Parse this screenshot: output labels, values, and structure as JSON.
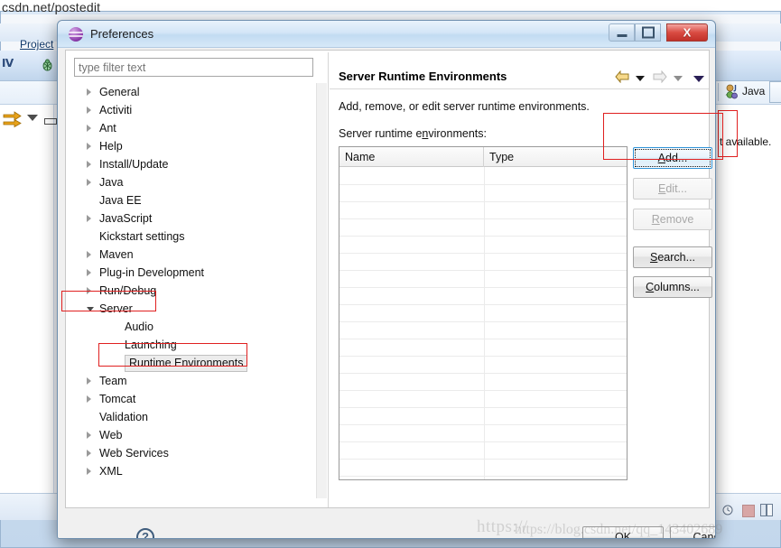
{
  "background": {
    "url_text": "csdn.net/postedit",
    "menu_project": "Project",
    "perspective_label": "Java",
    "editor_text": "t available.",
    "icons": {
      "debug": "bug-icon",
      "run": "run-icon",
      "arrows": "link-arrows-icon",
      "clock": "clock-icon",
      "stop": "stop-icon",
      "panes": "panes-icon"
    }
  },
  "dialog": {
    "title": "Preferences",
    "window_controls": {
      "minimize": "minimize-icon",
      "maximize": "maximize-icon",
      "close": "X"
    },
    "filter": {
      "value": "",
      "placeholder": "type filter text"
    },
    "tree": [
      {
        "label": "General",
        "indent": 0,
        "twisty": "collapsed",
        "selected": false
      },
      {
        "label": "Activiti",
        "indent": 0,
        "twisty": "collapsed",
        "selected": false
      },
      {
        "label": "Ant",
        "indent": 0,
        "twisty": "collapsed",
        "selected": false
      },
      {
        "label": "Help",
        "indent": 0,
        "twisty": "collapsed",
        "selected": false
      },
      {
        "label": "Install/Update",
        "indent": 0,
        "twisty": "collapsed",
        "selected": false
      },
      {
        "label": "Java",
        "indent": 0,
        "twisty": "collapsed",
        "selected": false
      },
      {
        "label": "Java EE",
        "indent": 0,
        "twisty": "none",
        "selected": false
      },
      {
        "label": "JavaScript",
        "indent": 0,
        "twisty": "collapsed",
        "selected": false
      },
      {
        "label": "Kickstart settings",
        "indent": 0,
        "twisty": "none",
        "selected": false
      },
      {
        "label": "Maven",
        "indent": 0,
        "twisty": "collapsed",
        "selected": false
      },
      {
        "label": "Plug-in Development",
        "indent": 0,
        "twisty": "collapsed",
        "selected": false
      },
      {
        "label": "Run/Debug",
        "indent": 0,
        "twisty": "collapsed",
        "selected": false
      },
      {
        "label": "Server",
        "indent": 0,
        "twisty": "expanded",
        "selected": false
      },
      {
        "label": "Audio",
        "indent": 1,
        "twisty": "none",
        "selected": false
      },
      {
        "label": "Launching",
        "indent": 1,
        "twisty": "none",
        "selected": false
      },
      {
        "label": "Runtime Environments",
        "indent": 1,
        "twisty": "none",
        "selected": true
      },
      {
        "label": "Team",
        "indent": 0,
        "twisty": "collapsed",
        "selected": false
      },
      {
        "label": "Tomcat",
        "indent": 0,
        "twisty": "collapsed",
        "selected": false
      },
      {
        "label": "Validation",
        "indent": 0,
        "twisty": "none",
        "selected": false
      },
      {
        "label": "Web",
        "indent": 0,
        "twisty": "collapsed",
        "selected": false
      },
      {
        "label": "Web Services",
        "indent": 0,
        "twisty": "collapsed",
        "selected": false
      },
      {
        "label": "XML",
        "indent": 0,
        "twisty": "collapsed",
        "selected": false
      }
    ],
    "page": {
      "title": "Server Runtime Environments",
      "description": "Add, remove, or edit server runtime environments.",
      "list_label": "Server runtime e",
      "list_label_mnemonic": "n",
      "list_label_rest": "vironments:",
      "nav": {
        "back": "back-arrow-icon",
        "back_menu": "chevron-down-icon",
        "forward": "forward-arrow-icon",
        "forward_menu": "chevron-down-icon",
        "view_menu": "chevron-down-icon"
      },
      "table": {
        "columns": [
          "Name",
          "Type"
        ],
        "rows": []
      },
      "buttons": [
        {
          "label": "Add...",
          "mnemonic": "A",
          "state": "focused"
        },
        {
          "label": "Edit...",
          "mnemonic": "E",
          "state": "disabled"
        },
        {
          "label": "Remove",
          "mnemonic": "R",
          "state": "disabled"
        },
        {
          "label": "Search...",
          "mnemonic": "S",
          "state": "enabled"
        },
        {
          "label": "Columns...",
          "mnemonic": "C",
          "state": "enabled"
        }
      ]
    },
    "footer": {
      "help": "?",
      "ok": "OK",
      "cancel": "Cancel"
    }
  },
  "annotations": {
    "highlight_color": "#e02020",
    "boxes": [
      "add-button",
      "server-node",
      "runtime-environments-node"
    ]
  },
  "watermark": {
    "line1": "https://",
    "line2": "https://blog.csdn.net/qq_143402689"
  }
}
